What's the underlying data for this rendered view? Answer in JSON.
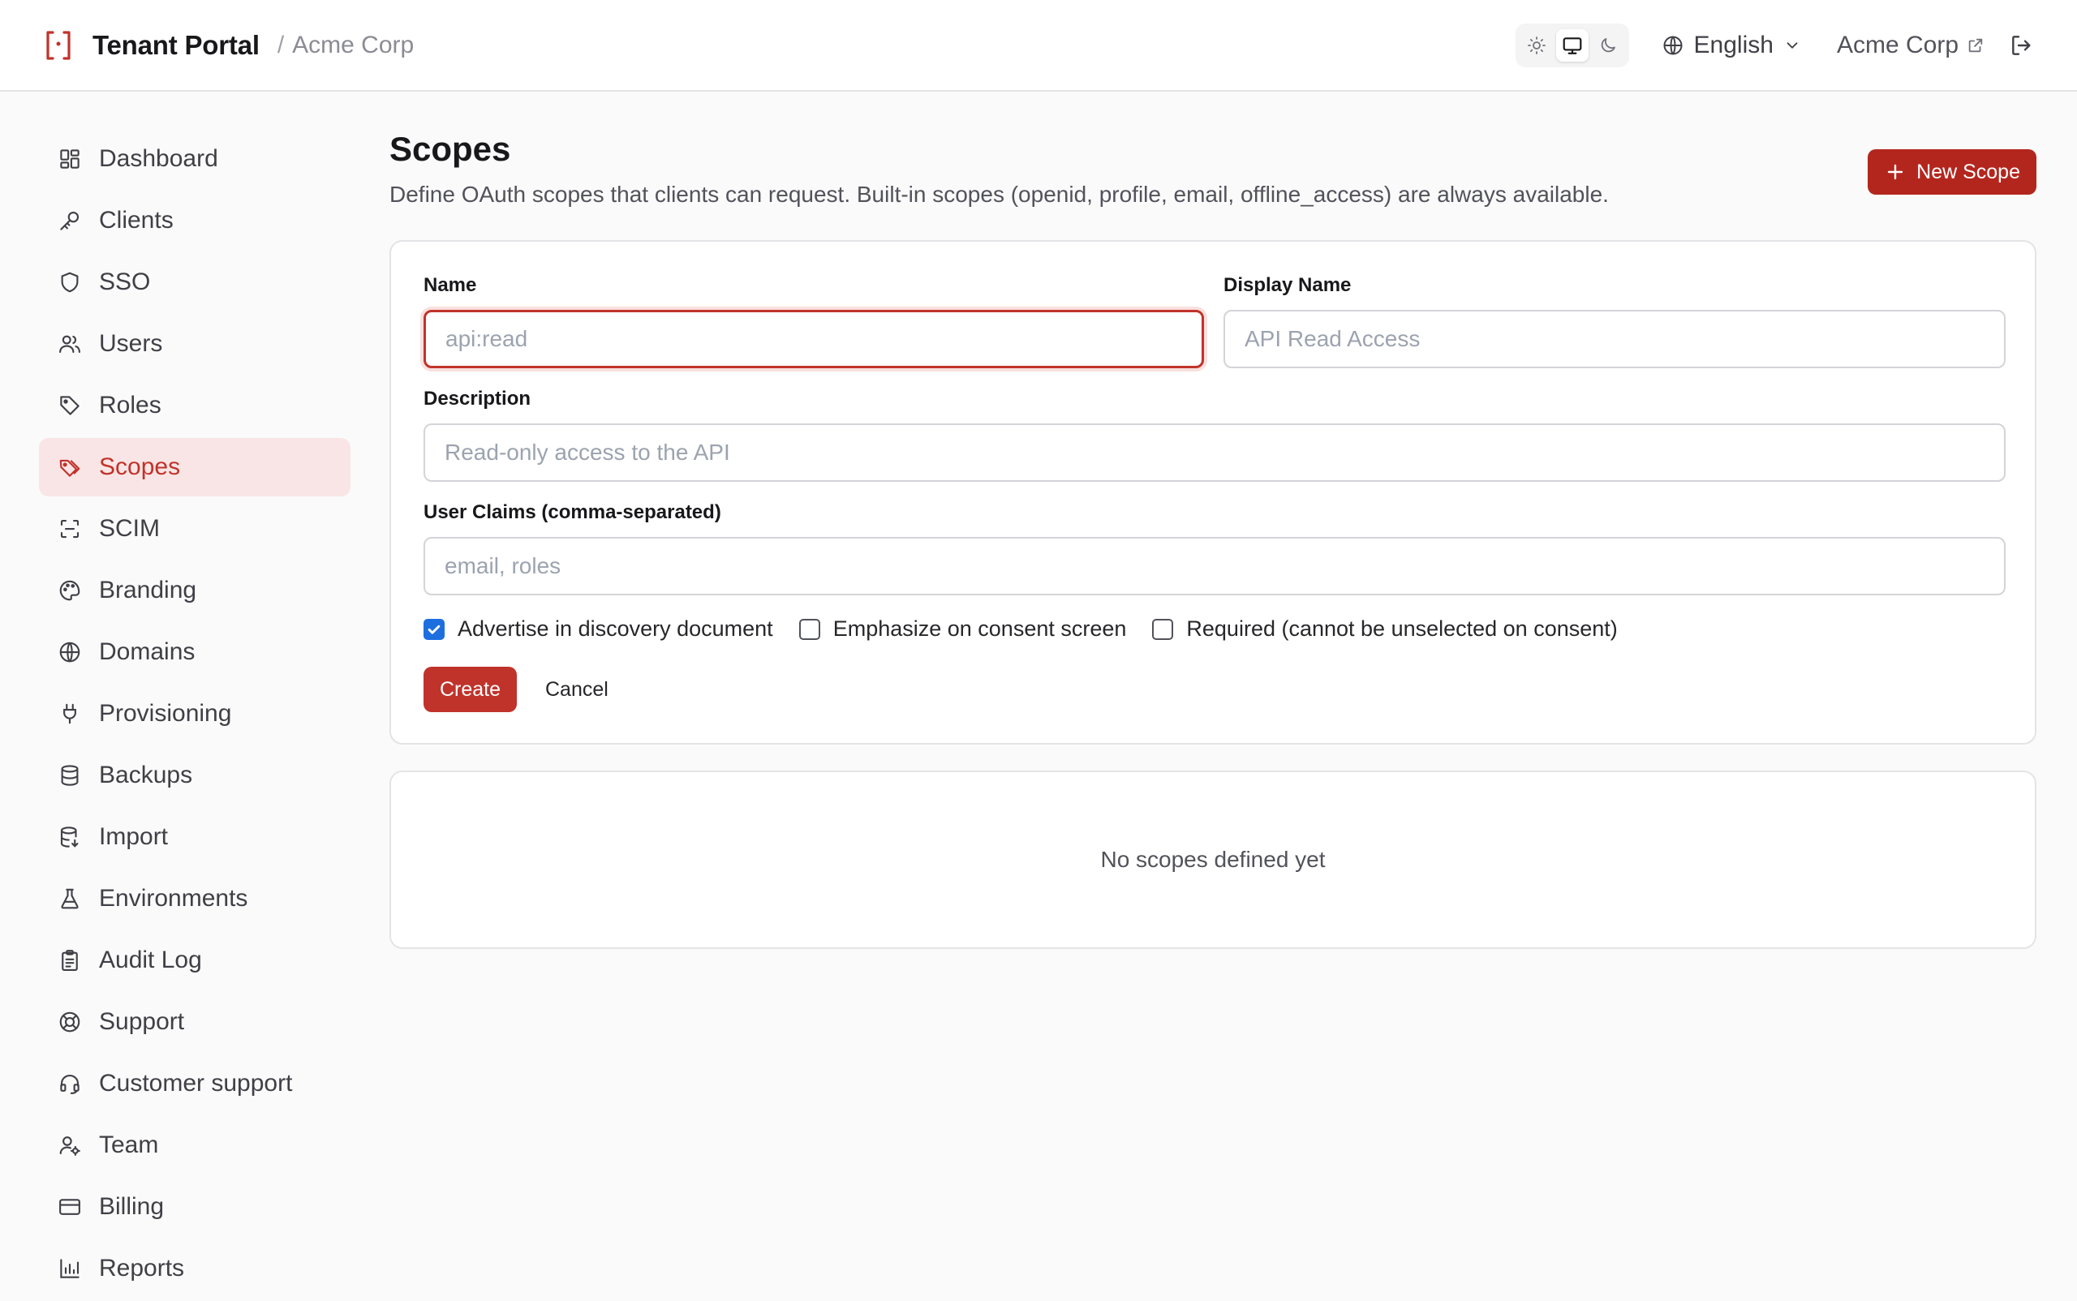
{
  "header": {
    "title": "Tenant Portal",
    "separator": "/",
    "tenant": "Acme Corp",
    "theme_options": [
      "sun-icon",
      "monitor-icon",
      "moon-icon"
    ],
    "theme_active": "monitor-icon",
    "language": "English",
    "tenant_link": "Acme Corp"
  },
  "sidebar": {
    "items": [
      {
        "label": "Dashboard",
        "icon": "dashboard-icon"
      },
      {
        "label": "Clients",
        "icon": "key-icon"
      },
      {
        "label": "SSO",
        "icon": "shield-icon"
      },
      {
        "label": "Users",
        "icon": "users-icon"
      },
      {
        "label": "Roles",
        "icon": "tag-icon"
      },
      {
        "label": "Scopes",
        "icon": "tags-icon",
        "active": true
      },
      {
        "label": "SCIM",
        "icon": "scan-icon"
      },
      {
        "label": "Branding",
        "icon": "palette-icon"
      },
      {
        "label": "Domains",
        "icon": "globe-icon"
      },
      {
        "label": "Provisioning",
        "icon": "plug-icon"
      },
      {
        "label": "Backups",
        "icon": "database-icon"
      },
      {
        "label": "Import",
        "icon": "database-import-icon"
      },
      {
        "label": "Environments",
        "icon": "flask-icon"
      },
      {
        "label": "Audit Log",
        "icon": "clipboard-icon"
      },
      {
        "label": "Support",
        "icon": "life-buoy-icon"
      },
      {
        "label": "Customer support",
        "icon": "headset-icon"
      },
      {
        "label": "Team",
        "icon": "user-gear-icon"
      },
      {
        "label": "Billing",
        "icon": "credit-card-icon"
      },
      {
        "label": "Reports",
        "icon": "bar-chart-icon"
      }
    ]
  },
  "main": {
    "title": "Scopes",
    "description": "Define OAuth scopes that clients can request. Built-in scopes (openid, profile, email, offline_access) are always available.",
    "new_button": "New Scope",
    "form": {
      "name_label": "Name",
      "name_placeholder": "api:read",
      "name_value": "",
      "display_label": "Display Name",
      "display_placeholder": "API Read Access",
      "display_value": "",
      "description_label": "Description",
      "description_placeholder": "Read-only access to the API",
      "description_value": "",
      "claims_label": "User Claims (comma-separated)",
      "claims_placeholder": "email, roles",
      "claims_value": "",
      "checkboxes": [
        {
          "label": "Advertise in discovery document",
          "checked": true
        },
        {
          "label": "Emphasize on consent screen",
          "checked": false
        },
        {
          "label": "Required (cannot be unselected on consent)",
          "checked": false
        }
      ],
      "create_button": "Create",
      "cancel_button": "Cancel"
    },
    "empty_text": "No scopes defined yet"
  },
  "colors": {
    "accent": "#c0332b",
    "accent_dark": "#b3261e",
    "active_nav_bg": "#f9e5e5",
    "checkbox_blue": "#1d6fe0"
  }
}
